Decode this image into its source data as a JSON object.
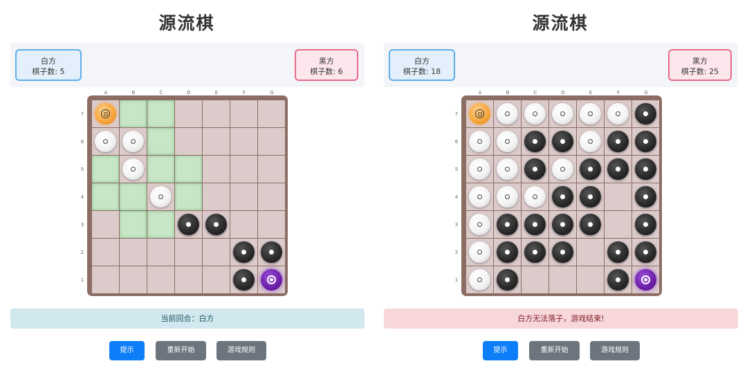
{
  "columns": [
    "A",
    "B",
    "C",
    "D",
    "E",
    "F",
    "G"
  ],
  "rows": [
    "7",
    "6",
    "5",
    "4",
    "3",
    "2",
    "1"
  ],
  "panels": [
    {
      "title": "源流棋",
      "white": {
        "name": "白方",
        "count_text": "棋子数: 5"
      },
      "black": {
        "name": "黑方",
        "count_text": "棋子数: 6"
      },
      "status": {
        "text": "当前回合：白方",
        "kind": "info"
      },
      "board": [
        [
          "S",
          "",
          "",
          "",
          "",
          "",
          ""
        ],
        [
          "W",
          "W",
          "",
          "",
          "",
          "",
          ""
        ],
        [
          "",
          "W",
          "",
          "",
          "",
          "",
          ""
        ],
        [
          "",
          "",
          "W",
          "",
          "",
          "",
          ""
        ],
        [
          "",
          "",
          "",
          "B",
          "B",
          "",
          ""
        ],
        [
          "",
          "",
          "",
          "",
          "",
          "B",
          "B"
        ],
        [
          "",
          "",
          "",
          "",
          "",
          "B",
          "T"
        ]
      ],
      "highlights": [
        [
          0,
          1
        ],
        [
          0,
          2
        ],
        [
          1,
          2
        ],
        [
          2,
          0
        ],
        [
          2,
          2
        ],
        [
          2,
          3
        ],
        [
          3,
          0
        ],
        [
          3,
          1
        ],
        [
          3,
          3
        ],
        [
          4,
          1
        ],
        [
          4,
          2
        ]
      ],
      "buttons": {
        "hint": "提示",
        "restart": "重新开始",
        "rules": "游戏规则"
      }
    },
    {
      "title": "源流棋",
      "white": {
        "name": "白方",
        "count_text": "棋子数: 18"
      },
      "black": {
        "name": "黑方",
        "count_text": "棋子数: 25"
      },
      "status": {
        "text": "白方无法落子，游戏结束!",
        "kind": "danger"
      },
      "board": [
        [
          "S",
          "W",
          "W",
          "W",
          "W",
          "W",
          "B"
        ],
        [
          "W",
          "W",
          "B",
          "B",
          "W",
          "B",
          "B"
        ],
        [
          "W",
          "W",
          "B",
          "W",
          "B",
          "B",
          "B"
        ],
        [
          "W",
          "W",
          "W",
          "B",
          "B",
          "",
          "B"
        ],
        [
          "W",
          "B",
          "B",
          "B",
          "B",
          "",
          "B"
        ],
        [
          "W",
          "B",
          "B",
          "B",
          "",
          "B",
          "B"
        ],
        [
          "W",
          "B",
          "",
          "",
          "",
          "B",
          "T"
        ]
      ],
      "highlights": [],
      "buttons": {
        "hint": "提示",
        "restart": "重新开始",
        "rules": "游戏规则"
      }
    }
  ],
  "colors": {
    "source_piece": "#f6a43a",
    "target_piece": "#6a1fa6",
    "highlight_cell": "#c7e6c7",
    "primary_button": "#0d7ef7",
    "secondary_button": "#6c757d"
  },
  "legend": {
    "S": "source-piece",
    "T": "target-piece",
    "W": "white-piece",
    "B": "black-piece"
  }
}
